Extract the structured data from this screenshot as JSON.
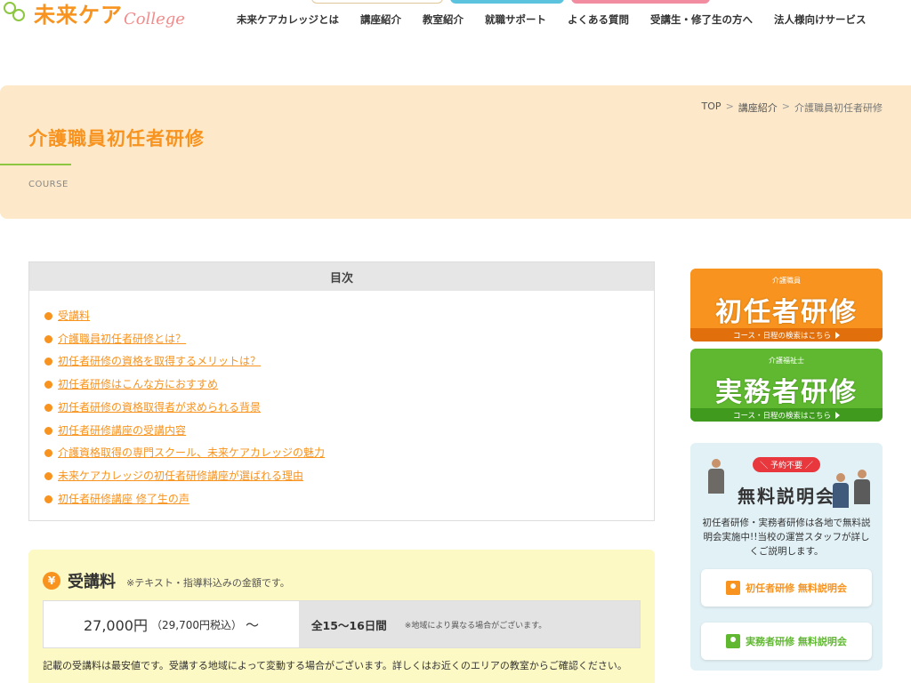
{
  "header": {
    "logo_jp": "未来ケア",
    "logo_en": "College",
    "nav": [
      "未来ケアカレッジとは",
      "講座紹介",
      "教室紹介",
      "就職サポート",
      "よくある質問",
      "受講生・修了生の方へ",
      "法人様向けサービス"
    ]
  },
  "breadcrumb": {
    "home": "TOP",
    "parent": "講座紹介",
    "current": "介護職員初任者研修",
    "sep": ">"
  },
  "page": {
    "title": "介護職員初任者研修",
    "subtitle": "COURSE"
  },
  "toc": {
    "heading": "目次",
    "items": [
      "受講料",
      "介護職員初任者研修とは？",
      "初任者研修の資格を取得するメリットは？",
      "初任者研修はこんな方におすすめ",
      "初任者研修の資格取得者が求められる背景",
      "初任者研修講座の受講内容",
      "介護資格取得の専門スクール、未来ケアカレッジの魅力",
      "未来ケアカレッジの初任者研修講座が選ばれる理由",
      "初任者研修講座 修了生の声"
    ]
  },
  "fee": {
    "icon": "¥",
    "title": "受講料",
    "note": "※テキスト・指導料込みの金額です。",
    "price": "27,000円",
    "tax": "（29,700円税込）",
    "tilde": "〜",
    "period": "全15〜16日間",
    "region_note": "※地域により異なる場合がございます。",
    "footnote": "記載の受講料は最安値です。受講する地域によって変動する場合がございます。詳しくはお近くのエリアの教室からご確認ください。"
  },
  "banners": {
    "shoninsha": {
      "small": "介護職員",
      "main": "初任者研修",
      "strip": "コース・日程の検索はこちら"
    },
    "jitsumusha": {
      "small": "介護福祉士",
      "main": "実務者研修",
      "strip": "コース・日程の検索はこちら"
    }
  },
  "session": {
    "badge": "＼ 予約不要 ／",
    "title": "無料説明会",
    "text": "初任者研修・実務者研修は各地で無料説明会実施中!!当校の運営スタッフが詳しくご説明します。",
    "btn1": "初任者研修 無料説明会",
    "btn2": "実務者研修 無料説明会"
  },
  "colors": {
    "accent_orange": "#f7931e",
    "accent_green": "#5fb830",
    "band": "#fde9c9",
    "badge_red": "#e8383d"
  }
}
